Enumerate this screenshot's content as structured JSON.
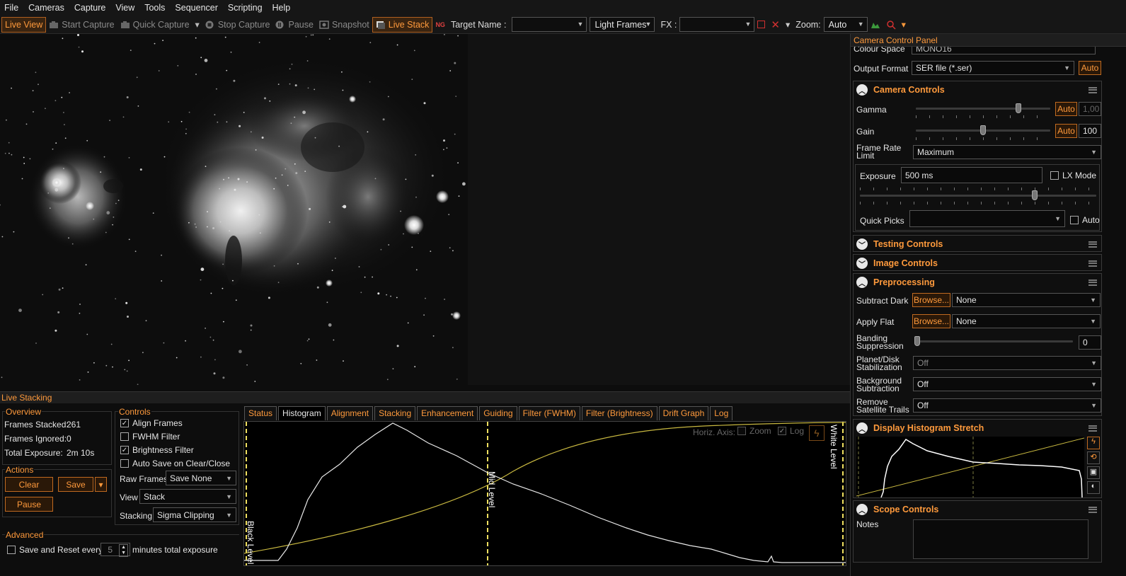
{
  "menu": [
    "File",
    "Cameras",
    "Capture",
    "View",
    "Tools",
    "Sequencer",
    "Scripting",
    "Help"
  ],
  "toolbar": {
    "live_view": "Live View",
    "start_capture": "Start Capture",
    "quick_capture": "Quick Capture",
    "stop_capture": "Stop Capture",
    "pause": "Pause",
    "snapshot": "Snapshot",
    "live_stack": "Live Stack",
    "target_name_label": "Target Name :",
    "target_name_value": "",
    "frame_type": "Light Frames",
    "fx_label": "FX :",
    "fx_value": "",
    "zoom_label": "Zoom:",
    "zoom_value": "Auto"
  },
  "right_panel": {
    "title": "Camera Control Panel",
    "colour_space_label": "Colour Space",
    "colour_space_value": "MONO16",
    "output_format_label": "Output Format",
    "output_format_value": "SER file (*.ser)",
    "auto": "Auto",
    "camera_controls": {
      "title": "Camera Controls",
      "gamma_label": "Gamma",
      "gamma_value": "1,00",
      "gain_label": "Gain",
      "gain_value": "100",
      "frame_rate_label_1": "Frame Rate",
      "frame_rate_label_2": "Limit",
      "frame_rate_value": "Maximum",
      "exposure_label": "Exposure",
      "exposure_value": "500 ms",
      "lx_mode": "LX Mode",
      "quick_picks_label": "Quick Picks",
      "quick_picks_value": "",
      "auto_label": "Auto"
    },
    "testing_controls": "Testing Controls",
    "image_controls": "Image Controls",
    "preprocessing": {
      "title": "Preprocessing",
      "subtract_dark_label": "Subtract Dark",
      "apply_flat_label": "Apply Flat",
      "browse": "Browse...",
      "none": "None",
      "banding_1": "Banding",
      "banding_2": "Suppression",
      "banding_value": "0",
      "planet_1": "Planet/Disk",
      "planet_2": "Stabilization",
      "background_1": "Background",
      "background_2": "Subtraction",
      "remove_1": "Remove",
      "remove_2": "Satellite Trails",
      "off": "Off"
    },
    "display_histogram": "Display Histogram Stretch",
    "scope_controls": "Scope Controls",
    "notes_label": "Notes"
  },
  "live_stacking": {
    "title": "Live Stacking",
    "overview_title": "Overview",
    "frames_stacked_label": "Frames Stacked:",
    "frames_stacked": "261",
    "frames_ignored_label": "Frames Ignored:",
    "frames_ignored": "0",
    "total_exposure_label": "Total Exposure:",
    "total_exposure": "2m 10s",
    "actions_title": "Actions",
    "clear": "Clear",
    "save": "Save",
    "pause": "Pause",
    "advanced_title": "Advanced",
    "save_reset_label": "Save and Reset every",
    "save_reset_value": "5",
    "save_reset_suffix": "minutes total exposure",
    "controls_title": "Controls",
    "align_frames": "Align Frames",
    "fwhm_filter": "FWHM Filter",
    "brightness_filter": "Brightness Filter",
    "auto_save": "Auto Save on Clear/Close",
    "raw_frames_label": "Raw Frames",
    "raw_frames_value": "Save None",
    "view_label": "View",
    "view_value": "Stack",
    "stacking_label": "Stacking",
    "stacking_value": "Sigma Clipping",
    "tabs": [
      "Status",
      "Histogram",
      "Alignment",
      "Stacking",
      "Enhancement",
      "Guiding",
      "Filter (FWHM)",
      "Filter (Brightness)",
      "Drift Graph",
      "Log"
    ],
    "active_tab": 1,
    "horiz_axis_label": "Horiz. Axis:",
    "zoom_label": "Zoom",
    "log_label": "Log",
    "black_level": "Black Level",
    "mid_level": "Mid Level",
    "white_level": "White Level"
  },
  "colors": {
    "accent": "#ff9a3c",
    "histogram_curve": "#e0d040",
    "level_marker": "#f0e060"
  }
}
